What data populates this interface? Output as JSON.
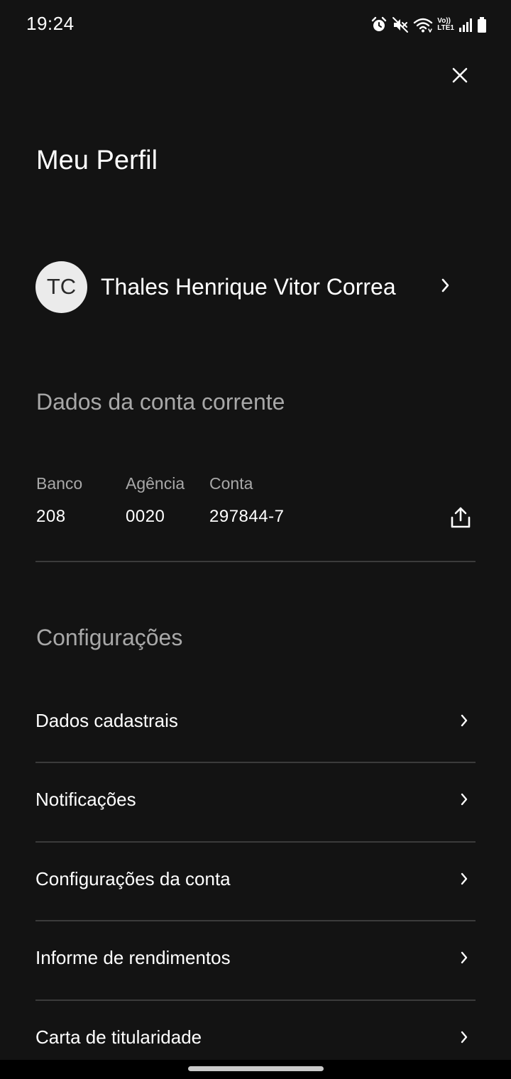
{
  "status_bar": {
    "time": "19:24",
    "icons": [
      "alarm-icon",
      "mute-icon",
      "wifi-icon",
      "volte-lte-icon",
      "signal-icon",
      "battery-icon"
    ],
    "volte_label": "Vo))",
    "lte_label": "LTE1"
  },
  "header": {
    "close_icon": "close-icon",
    "title": "Meu Perfil"
  },
  "profile": {
    "initials": "TC",
    "name": "Thales Henrique Vitor Correa",
    "chevron_icon": "chevron-right-icon"
  },
  "account": {
    "section_title": "Dados da conta corrente",
    "bank_label": "Banco",
    "bank_value": "208",
    "agency_label": "Agência",
    "agency_value": "0020",
    "account_label": "Conta",
    "account_value": "297844-7",
    "share_icon": "share-icon"
  },
  "settings": {
    "section_title": "Configurações",
    "items": [
      {
        "label": "Dados cadastrais"
      },
      {
        "label": "Notificações"
      },
      {
        "label": "Configurações da conta"
      },
      {
        "label": "Informe de rendimentos"
      },
      {
        "label": "Carta de titularidade"
      }
    ]
  },
  "colors": {
    "background": "#131313",
    "text_primary": "#ffffff",
    "text_secondary": "#a8a8a8",
    "divider": "#3b3b3b",
    "avatar_bg": "#ebebeb"
  }
}
